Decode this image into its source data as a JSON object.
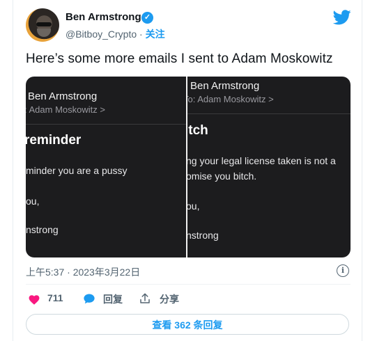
{
  "author": {
    "name": "Ben Armstrong",
    "verified_mark": "✓",
    "handle": "@Bitboy_Crypto",
    "separator": "·",
    "follow_label": "关注"
  },
  "tweet": {
    "text": "Here’s some more emails I sent to Adam Moskowitz"
  },
  "email_left": {
    "sender": "Ben Armstrong",
    "to": ": Adam Moskowitz >",
    "subject": "reminder",
    "line1": "minder you are a pussy",
    "line2": "ou,",
    "line3": "nstrong"
  },
  "email_right": {
    "sender": "Ben Armstrong",
    "to": "To: Adam Moskowitz >",
    "subject": "itch",
    "line1": "ng your legal license taken is not a",
    "line2": "omise you bitch.",
    "line3": "ou,",
    "line4": "nstrong"
  },
  "meta": {
    "timestamp": "上午5:37 · 2023年3月22日",
    "info_icon": "i"
  },
  "actions": {
    "likes": "711",
    "reply_label": "回复",
    "share_label": "分享"
  },
  "footer": {
    "view_replies": "查看 362 条回复"
  },
  "icons": {
    "avatar": "avatar",
    "verified": "verified-badge-icon",
    "twitter": "twitter-bird-icon",
    "heart": "heart-icon",
    "reply": "reply-bubble-icon",
    "share": "share-icon",
    "info": "info-icon"
  },
  "colors": {
    "accent": "#1d9bf0",
    "heart": "#f91880",
    "muted": "#536471",
    "media_bg": "#1c1c1e"
  }
}
